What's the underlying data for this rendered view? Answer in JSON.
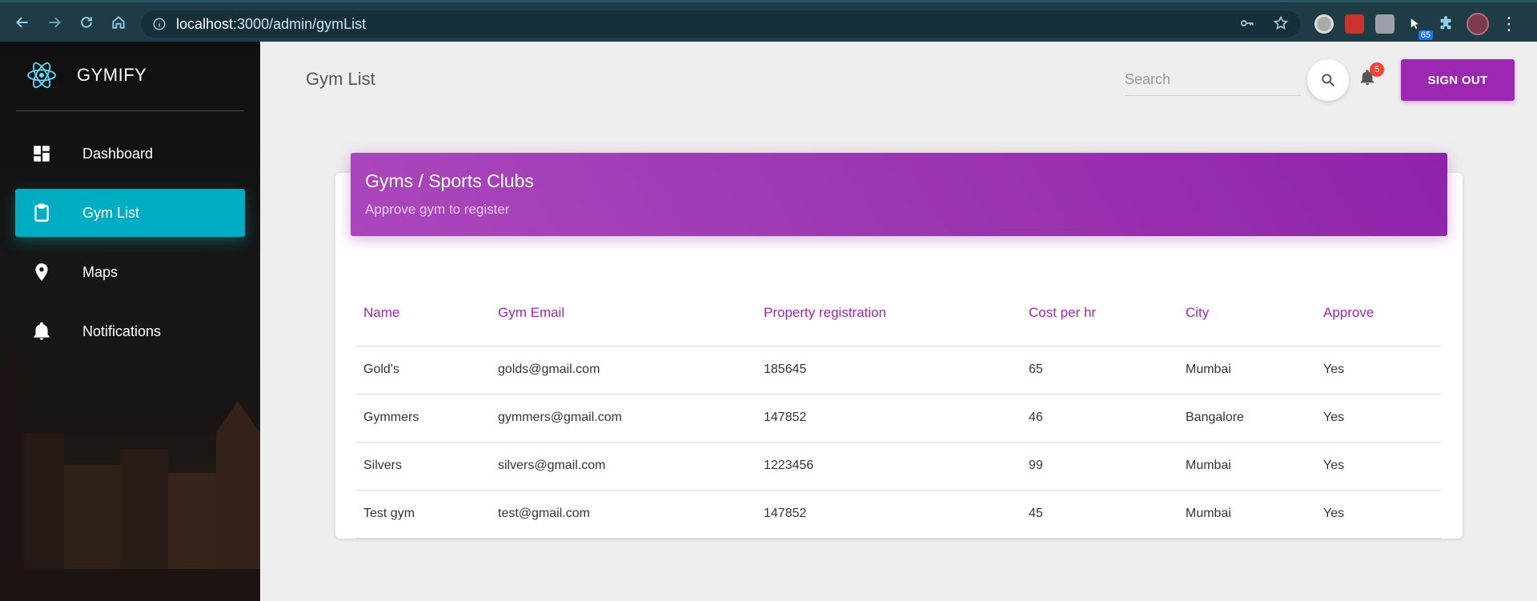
{
  "browser": {
    "url_host": "localhost",
    "url_path": ":3000/admin/gymList",
    "extension_badge": "65"
  },
  "sidebar": {
    "brand": "GYMIFY",
    "items": [
      {
        "label": "Dashboard",
        "icon": "dashboard-icon",
        "active": false
      },
      {
        "label": "Gym List",
        "icon": "clipboard-icon",
        "active": true
      },
      {
        "label": "Maps",
        "icon": "location-pin-icon",
        "active": false
      },
      {
        "label": "Notifications",
        "icon": "bell-icon",
        "active": false
      }
    ]
  },
  "header": {
    "title": "Gym List",
    "search_placeholder": "Search",
    "notification_count": "5",
    "signout_label": "SIGN OUT"
  },
  "card": {
    "title": "Gyms / Sports Clubs",
    "subtitle": "Approve gym to register"
  },
  "table": {
    "columns": [
      "Name",
      "Gym Email",
      "Property registration",
      "Cost per hr",
      "City",
      "Approve"
    ],
    "rows": [
      [
        "Gold's",
        "golds@gmail.com",
        "185645",
        "65",
        "Mumbai",
        "Yes"
      ],
      [
        "Gymmers",
        "gymmers@gmail.com",
        "147852",
        "46",
        "Bangalore",
        "Yes"
      ],
      [
        "Silvers",
        "silvers@gmail.com",
        "1223456",
        "99",
        "Mumbai",
        "Yes"
      ],
      [
        "Test gym",
        "test@gmail.com",
        "147852",
        "45",
        "Mumbai",
        "Yes"
      ]
    ]
  },
  "colors": {
    "accent_purple": "#9c27b0",
    "active_cyan": "#00acc1",
    "browser_bar": "#1f3b46"
  }
}
